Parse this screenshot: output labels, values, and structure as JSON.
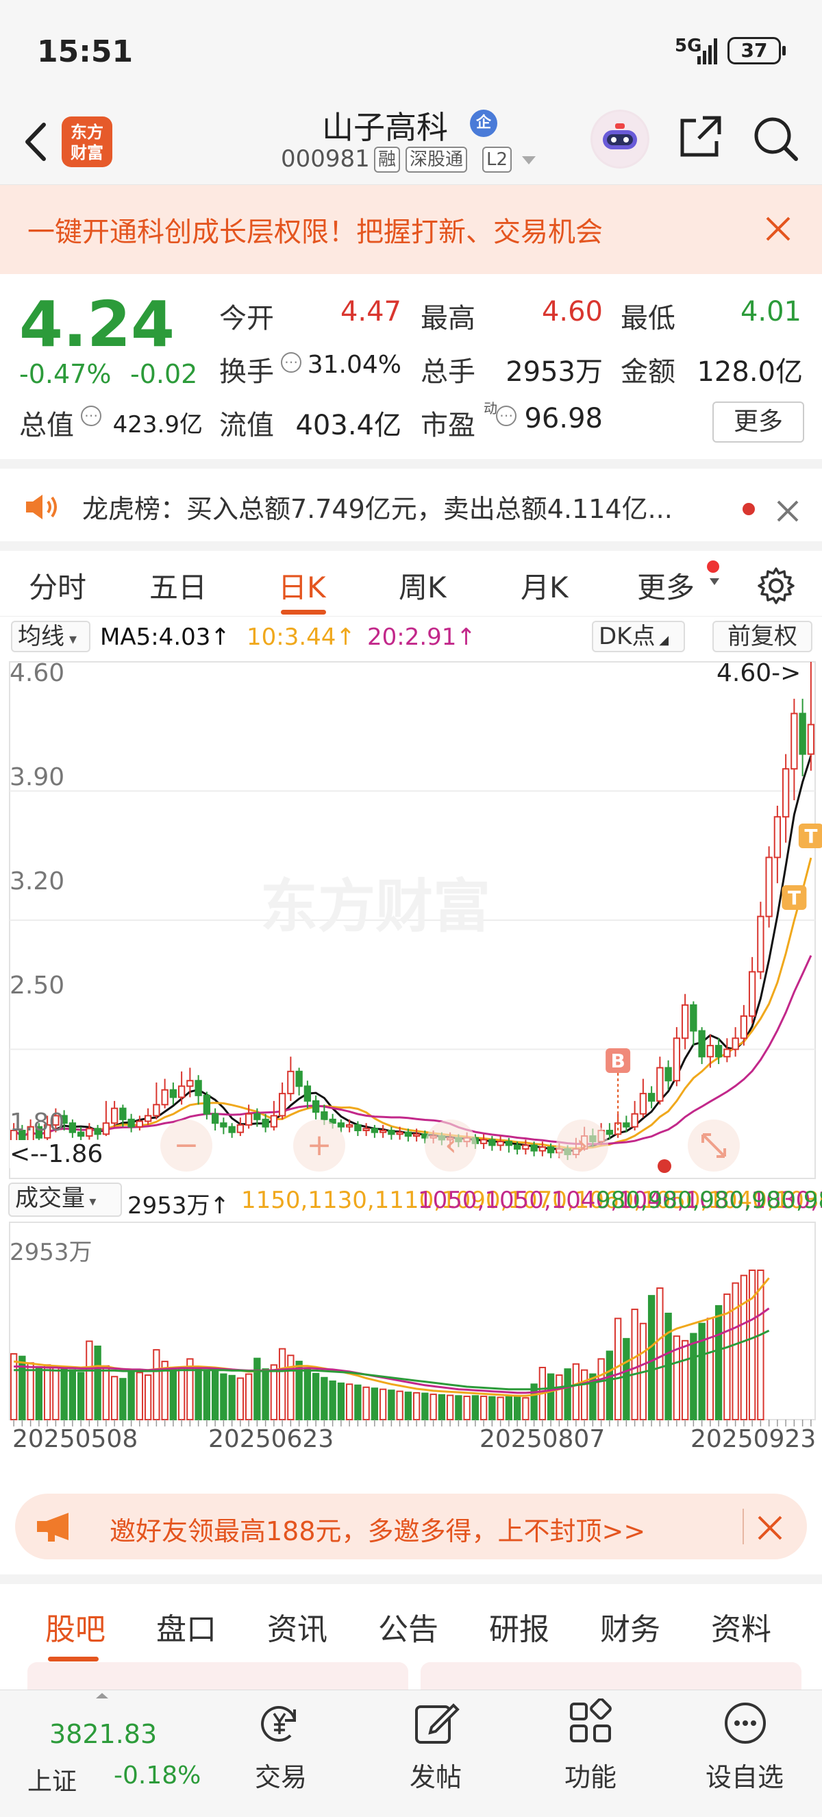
{
  "status": {
    "time": "15:51",
    "network": "5G",
    "battery": "37"
  },
  "header": {
    "logo_line1": "东方",
    "logo_line2": "财富",
    "stock_name": "山子高科",
    "reg_badge": "企",
    "stock_code": "000981",
    "tags": [
      "融",
      "深股通",
      "L2"
    ]
  },
  "banner": {
    "text": "一键开通科创成长层权限！把握打新、交易机会"
  },
  "quote": {
    "price": "4.24",
    "change_pct": "-0.47%",
    "change_abs": "-0.02",
    "fields": {
      "open_label": "今开",
      "open": "4.47",
      "high_label": "最高",
      "high": "4.60",
      "low_label": "最低",
      "low": "4.01",
      "turnover_label": "换手",
      "turnover": "31.04%",
      "vol_label": "总手",
      "vol": "2953万",
      "amount_label": "金额",
      "amount": "128.0亿",
      "mcap_label": "总值",
      "mcap": "423.9亿",
      "float_label": "流值",
      "float": "403.4亿",
      "pe_label": "市盈",
      "pe_sup": "动",
      "pe": "96.98"
    },
    "more_label": "更多"
  },
  "dragon_tiger": {
    "text": "龙虎榜：买入总额7.749亿元，卖出总额4.114亿..."
  },
  "kline_tabs": [
    {
      "label": "分时"
    },
    {
      "label": "五日"
    },
    {
      "label": "日K"
    },
    {
      "label": "周K"
    },
    {
      "label": "月K"
    },
    {
      "label": "更多"
    }
  ],
  "ma_row": {
    "selector": "均线",
    "ma5": "MA5:4.03↑",
    "ma10": "10:3.44↑",
    "ma20": "20:2.91↑",
    "dk_label": "DK点",
    "adjust_label": "前复权"
  },
  "colors": {
    "up": "#d9362f",
    "down": "#2c9b3a",
    "ma5": "#111111",
    "ma10": "#f0a81c",
    "ma20": "#c2288a",
    "accent": "#e4551f"
  },
  "chart_data": {
    "type": "candlestick",
    "y_ticks": [
      "4.60",
      "3.90",
      "3.20",
      "2.50",
      "1.80"
    ],
    "ylim": [
      1.8,
      4.6
    ],
    "high_label": "4.60->",
    "low_label": "<--1.86",
    "volume_selector": "成交量",
    "volume_value": "2953万↑",
    "vol_ma1": [
      1150,
      1130,
      1110,
      1090,
      1070,
      1060,
      1050,
      1040,
      1030,
      1040,
      1060,
      1050,
      1020,
      1000,
      990,
      980,
      980,
      1000,
      1020,
      1030,
      1040,
      1050,
      1050,
      1040,
      1030,
      1010,
      990,
      970,
      950,
      960,
      970,
      980,
      1010,
      1040,
      1060,
      1060,
      1040,
      1010,
      980,
      950,
      910,
      870,
      820,
      780,
      740,
      700,
      670,
      640,
      610,
      590,
      570,
      560,
      550,
      540,
      530,
      520,
      510,
      500,
      490,
      480,
      470,
      470,
      490,
      520,
      560,
      600,
      640,
      700,
      760,
      820,
      880,
      960,
      1050,
      1140,
      1230,
      1330,
      1450,
      1600,
      1720,
      1800,
      1850,
      1900,
      1950,
      2000,
      2050,
      2100,
      2200,
      2300,
      2400,
      2600,
      2800
    ],
    "vol_ma2": [
      1050,
      1050,
      1040,
      1040,
      1030,
      1030,
      1020,
      1020,
      1010,
      1010,
      1020,
      1020,
      1010,
      1000,
      990,
      990,
      980,
      990,
      1000,
      1010,
      1020,
      1020,
      1020,
      1020,
      1010,
      1000,
      990,
      980,
      970,
      970,
      970,
      980,
      990,
      1000,
      1010,
      1020,
      1010,
      1000,
      990,
      970,
      950,
      920,
      890,
      860,
      830,
      800,
      770,
      740,
      710,
      680,
      660,
      640,
      620,
      600,
      590,
      580,
      570,
      560,
      550,
      540,
      530,
      530,
      540,
      560,
      580,
      610,
      640,
      680,
      720,
      760,
      800,
      850,
      900,
      960,
      1020,
      1090,
      1160,
      1240,
      1320,
      1390,
      1450,
      1510,
      1560,
      1620,
      1680,
      1750,
      1820,
      1900,
      1980,
      2080,
      2200
    ],
    "vol_ma3": [
      980,
      980,
      980,
      980,
      980,
      970,
      970,
      970,
      970,
      970,
      970,
      970,
      970,
      960,
      960,
      960,
      960,
      960,
      970,
      970,
      980,
      980,
      980,
      980,
      980,
      980,
      970,
      970,
      960,
      960,
      960,
      960,
      960,
      970,
      970,
      970,
      970,
      960,
      950,
      940,
      930,
      910,
      890,
      870,
      850,
      830,
      810,
      790,
      770,
      750,
      730,
      710,
      690,
      670,
      650,
      640,
      630,
      620,
      610,
      600,
      600,
      600,
      600,
      610,
      620,
      640,
      660,
      680,
      700,
      730,
      760,
      790,
      820,
      860,
      900,
      940,
      980,
      1030,
      1080,
      1130,
      1180,
      1230,
      1280,
      1330,
      1380,
      1430,
      1490,
      1550,
      1610,
      1680,
      1760
    ],
    "volume_max_label": "2953万",
    "x_labels": [
      "20250508",
      "20250623",
      "20250807",
      "20250923"
    ],
    "candles": [
      [
        1.95,
        2.06,
        2.1,
        1.9
      ],
      [
        2.06,
        2.0,
        2.09,
        1.96
      ],
      [
        2.0,
        2.08,
        2.12,
        1.98
      ],
      [
        2.08,
        2.02,
        2.1,
        1.99
      ],
      [
        2.02,
        2.09,
        2.14,
        2.0
      ],
      [
        2.09,
        2.14,
        2.18,
        2.05
      ],
      [
        2.14,
        2.1,
        2.17,
        2.06
      ],
      [
        2.1,
        2.05,
        2.12,
        2.02
      ],
      [
        2.05,
        2.03,
        2.08,
        2.0
      ],
      [
        2.03,
        2.07,
        2.1,
        2.01
      ],
      [
        2.07,
        2.04,
        2.09,
        2.01
      ],
      [
        2.04,
        2.1,
        2.22,
        2.03
      ],
      [
        2.1,
        2.18,
        2.22,
        2.08
      ],
      [
        2.18,
        2.12,
        2.2,
        2.08
      ],
      [
        2.12,
        2.08,
        2.15,
        2.05
      ],
      [
        2.08,
        2.11,
        2.14,
        2.06
      ],
      [
        2.11,
        2.14,
        2.18,
        2.09
      ],
      [
        2.14,
        2.2,
        2.32,
        2.12
      ],
      [
        2.2,
        2.28,
        2.34,
        2.18
      ],
      [
        2.28,
        2.24,
        2.32,
        2.2
      ],
      [
        2.24,
        2.3,
        2.38,
        2.2
      ],
      [
        2.3,
        2.33,
        2.4,
        2.24
      ],
      [
        2.33,
        2.25,
        2.36,
        2.2
      ],
      [
        2.25,
        2.15,
        2.27,
        2.12
      ],
      [
        2.15,
        2.1,
        2.18,
        2.06
      ],
      [
        2.1,
        2.08,
        2.13,
        2.04
      ],
      [
        2.08,
        2.05,
        2.1,
        2.02
      ],
      [
        2.05,
        2.09,
        2.13,
        2.03
      ],
      [
        2.09,
        2.15,
        2.2,
        2.07
      ],
      [
        2.15,
        2.12,
        2.18,
        2.08
      ],
      [
        2.12,
        2.08,
        2.15,
        2.05
      ],
      [
        2.08,
        2.14,
        2.22,
        2.06
      ],
      [
        2.14,
        2.26,
        2.32,
        2.12
      ],
      [
        2.26,
        2.38,
        2.46,
        2.22
      ],
      [
        2.38,
        2.3,
        2.4,
        2.25
      ],
      [
        2.3,
        2.22,
        2.33,
        2.18
      ],
      [
        2.22,
        2.16,
        2.25,
        2.12
      ],
      [
        2.16,
        2.12,
        2.2,
        2.09
      ],
      [
        2.12,
        2.1,
        2.15,
        2.07
      ],
      [
        2.1,
        2.08,
        2.12,
        2.05
      ],
      [
        2.08,
        2.09,
        2.12,
        2.05
      ],
      [
        2.09,
        2.06,
        2.11,
        2.03
      ],
      [
        2.06,
        2.07,
        2.1,
        2.03
      ],
      [
        2.07,
        2.05,
        2.09,
        2.02
      ],
      [
        2.05,
        2.06,
        2.09,
        2.02
      ],
      [
        2.06,
        2.04,
        2.08,
        2.01
      ],
      [
        2.04,
        2.05,
        2.08,
        2.01
      ],
      [
        2.05,
        2.03,
        2.07,
        2.0
      ],
      [
        2.03,
        2.04,
        2.07,
        2.0
      ],
      [
        2.04,
        2.02,
        2.06,
        1.99
      ],
      [
        2.02,
        2.03,
        2.06,
        1.99
      ],
      [
        2.03,
        2.01,
        2.05,
        1.98
      ],
      [
        2.01,
        2.02,
        2.05,
        1.97
      ],
      [
        2.02,
        2.0,
        2.04,
        1.97
      ],
      [
        2.0,
        2.02,
        2.05,
        1.97
      ],
      [
        2.02,
        1.99,
        2.04,
        1.96
      ],
      [
        1.99,
        2.01,
        2.04,
        1.96
      ],
      [
        2.01,
        1.98,
        2.03,
        1.95
      ],
      [
        1.98,
        2.0,
        2.03,
        1.95
      ],
      [
        2.0,
        1.98,
        2.02,
        1.94
      ],
      [
        1.98,
        1.96,
        2.0,
        1.93
      ],
      [
        1.96,
        1.98,
        2.01,
        1.93
      ],
      [
        1.98,
        1.95,
        2.0,
        1.92
      ],
      [
        1.95,
        1.97,
        2.0,
        1.92
      ],
      [
        1.97,
        1.94,
        1.99,
        1.91
      ],
      [
        1.94,
        1.96,
        1.99,
        1.91
      ],
      [
        1.96,
        1.93,
        1.98,
        1.9
      ],
      [
        1.93,
        1.96,
        2.02,
        1.91
      ],
      [
        1.96,
        2.03,
        2.08,
        1.95
      ],
      [
        2.03,
        2.0,
        2.07,
        1.97
      ],
      [
        2.0,
        2.06,
        2.1,
        1.98
      ],
      [
        2.06,
        2.04,
        2.1,
        2.01
      ],
      [
        2.04,
        2.1,
        2.15,
        2.02
      ],
      [
        2.1,
        2.08,
        2.14,
        2.05
      ],
      [
        2.08,
        2.15,
        2.22,
        2.06
      ],
      [
        2.15,
        2.26,
        2.34,
        2.13
      ],
      [
        2.26,
        2.22,
        2.3,
        2.18
      ],
      [
        2.22,
        2.4,
        2.46,
        2.2
      ],
      [
        2.4,
        2.33,
        2.44,
        2.28
      ],
      [
        2.33,
        2.56,
        2.62,
        2.3
      ],
      [
        2.56,
        2.74,
        2.8,
        2.5
      ],
      [
        2.74,
        2.6,
        2.76,
        2.52
      ],
      [
        2.6,
        2.46,
        2.62,
        2.42
      ],
      [
        2.46,
        2.52,
        2.58,
        2.4
      ],
      [
        2.52,
        2.46,
        2.56,
        2.42
      ],
      [
        2.46,
        2.5,
        2.56,
        2.43
      ],
      [
        2.5,
        2.56,
        2.62,
        2.46
      ],
      [
        2.56,
        2.68,
        2.74,
        2.52
      ],
      [
        2.68,
        2.92,
        3.0,
        2.64
      ],
      [
        2.92,
        3.22,
        3.3,
        2.88
      ],
      [
        3.22,
        3.54,
        3.6,
        3.16
      ],
      [
        3.54,
        3.76,
        3.82,
        3.4
      ],
      [
        3.76,
        4.02,
        4.1,
        3.62
      ],
      [
        4.02,
        4.32,
        4.4,
        3.85
      ],
      [
        4.32,
        4.1,
        4.4,
        3.98
      ],
      [
        4.1,
        4.26,
        4.6,
        4.01
      ]
    ],
    "volume": [
      1300,
      1250,
      1120,
      1010,
      1080,
      1050,
      990,
      980,
      930,
      1550,
      1450,
      1060,
      850,
      810,
      960,
      930,
      880,
      1380,
      1150,
      1000,
      1040,
      1200,
      1040,
      980,
      960,
      900,
      870,
      820,
      900,
      1210,
      1000,
      1080,
      1400,
      1270,
      1150,
      1020,
      910,
      830,
      760,
      720,
      700,
      680,
      640,
      620,
      600,
      580,
      560,
      540,
      530,
      520,
      500,
      490,
      480,
      470,
      460,
      470,
      460,
      450,
      440,
      450,
      440,
      430,
      700,
      1030,
      900,
      880,
      1000,
      1100,
      980,
      900,
      1200,
      1350,
      2000,
      1600,
      2180,
      1900,
      2450,
      2600,
      2100,
      1650,
      1560,
      1700,
      1900,
      2000,
      2250,
      2480,
      2700,
      2850,
      2953,
      2953
    ]
  },
  "promo": {
    "text": "邀好友领最高188元，多邀多得，上不封顶>>"
  },
  "bottom_tabs": [
    {
      "label": "股吧"
    },
    {
      "label": "盘口"
    },
    {
      "label": "资讯"
    },
    {
      "label": "公告"
    },
    {
      "label": "研报"
    },
    {
      "label": "财务"
    },
    {
      "label": "资料"
    }
  ],
  "bottom_nav": {
    "index_value": "3821.83",
    "index_name": "上证",
    "index_change": "-0.18%",
    "items": [
      {
        "label": "交易"
      },
      {
        "label": "发帖"
      },
      {
        "label": "功能"
      },
      {
        "label": "设自选"
      }
    ]
  }
}
